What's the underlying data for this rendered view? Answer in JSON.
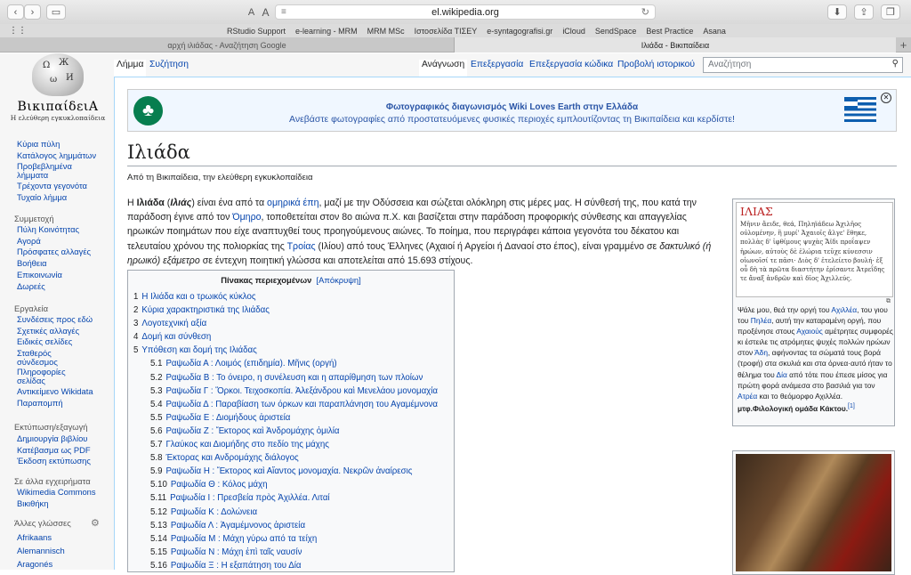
{
  "browser": {
    "address": "el.wikipedia.org",
    "favorites": [
      "RStudio Support",
      "e-learning - MRM",
      "MRM MSc",
      "Ιστοσελίδα ΤΙΣΕΥ",
      "e-syntagografisi.gr",
      "iCloud",
      "SendSpace",
      "Best Practice",
      "Asana"
    ],
    "tabs": [
      "αρχή ιλιάδας - Αναζήτηση Google",
      "Ιλιάδα - Βικιπαίδεια"
    ],
    "reader_a_small": "A",
    "reader_a_large": "A"
  },
  "logo": {
    "wordmark": "ΒικιπαίδειΑ",
    "tagline": "Η ελεύθερη εγκυκλοπαίδεια"
  },
  "nav": {
    "main": [
      "Κύρια πύλη",
      "Κατάλογος λημμάτων",
      "Προβεβλημένα λήμματα",
      "Τρέχοντα γεγονότα",
      "Τυχαίο λήμμα"
    ],
    "community_head": "Συμμετοχή",
    "community": [
      "Πύλη Κοινότητας",
      "Αγορά",
      "Πρόσφατες αλλαγές",
      "Βοήθεια",
      "Επικοινωνία",
      "Δωρεές"
    ],
    "tools_head": "Εργαλεία",
    "tools": [
      "Συνδέσεις προς εδώ",
      "Σχετικές αλλαγές",
      "Ειδικές σελίδες",
      "Σταθερός σύνδεσμος",
      "Πληροφορίες σελίδας",
      "Αντικείμενο Wikidata",
      "Παραπομπή"
    ],
    "print_head": "Εκτύπωση/εξαγωγή",
    "print": [
      "Δημιουργία βιβλίου",
      "Κατέβασμα ως PDF",
      "Έκδοση εκτύπωσης"
    ],
    "projects_head": "Σε άλλα εγχειρήματα",
    "projects": [
      "Wikimedia Commons",
      "Βικιθήκη"
    ],
    "lang_head": "Άλλες γλώσσες",
    "langs": [
      "Afrikaans",
      "Alemannisch",
      "Aragonés"
    ]
  },
  "tabs": {
    "article": "Λήμμα",
    "talk": "Συζήτηση",
    "read": "Ανάγνωση",
    "edit": "Επεξεργασία",
    "edit_code": "Επεξεργασία κώδικα",
    "history": "Προβολή ιστορικού",
    "search_placeholder": "Αναζήτηση"
  },
  "banner": {
    "title": "Φωτογραφικός διαγωνισμός Wiki Loves Earth στην Ελλάδα",
    "text": "Ανεβάστε φωτογραφίες από προστατευόμενες φυσικές περιοχές εμπλουτίζοντας τη Βικιπαίδεια και κερδίστε!"
  },
  "article": {
    "title": "Ιλιάδα",
    "from": "Από τη Βικιπαίδεια, την ελεύθερη εγκυκλοπαίδεια",
    "p": [
      "Η ",
      "Ιλιάδα",
      " (",
      "Ιλιάς",
      ") είναι ένα από τα ",
      "ομηρικά έπη",
      ", μαζί με την Οδύσσεια και σώζεται ολόκληρη στις μέρες μας. Η σύνθεσή της, που κατά την παράδοση έγινε από τον ",
      "Όμηρο",
      ", τοποθετείται στον 8ο αιώνα π.Χ. και βασίζεται στην παράδοση προφορικής σύνθεσης και απαγγελίας ηρωικών ποιημάτων που είχε αναπτυχθεί τους προηγούμενους αιώνες. Το ποίημα, που περιγράφει κάποια γεγονότα του δέκατου και τελευταίου χρόνου της πολιορκίας της ",
      "Τροίας",
      " (Ιλίου) από τους Έλληνες (Αχαιοί ή Αργείοι ή Δαναοί στο έπος), είναι γραμμένο σε ",
      "δακτυλικό (ή ηρωικό) εξάμετρο",
      " σε έντεχνη ποιητική γλώσσα και αποτελείται από 15.693 στίχους."
    ]
  },
  "toc": {
    "title": "Πίνακας περιεχομένων",
    "hide": "[Απόκρυψη]",
    "items": [
      {
        "n": "1",
        "t": "Η Ιλιάδα και ο τρωικός κύκλος",
        "sub": false
      },
      {
        "n": "2",
        "t": "Κύρια χαρακτηριστικά της Ιλιάδας",
        "sub": false
      },
      {
        "n": "3",
        "t": "Λογοτεχνική αξία",
        "sub": false
      },
      {
        "n": "4",
        "t": "Δομή και σύνθεση",
        "sub": false
      },
      {
        "n": "5",
        "t": "Υπόθεση και δομή της Ιλιάδας",
        "sub": false
      },
      {
        "n": "5.1",
        "t": "Ραψωδία Α : Λοιμός (επιδημία). Μῆνις (οργή)",
        "sub": true
      },
      {
        "n": "5.2",
        "t": "Ραψωδία Β : Το όνειρο, η συνέλευση και η απαρίθμηση των πλοίων",
        "sub": true
      },
      {
        "n": "5.3",
        "t": "Ραψωδία Γ : Ὅρκοι. Τειχοσκοπία. Ἀλεξάνδρου καὶ Μενελάου μονομαχία",
        "sub": true
      },
      {
        "n": "5.4",
        "t": "Ραψωδία Δ : Παραβίαση των όρκων και παραπλάνηση του Αγαμέμνονα",
        "sub": true
      },
      {
        "n": "5.5",
        "t": "Ραψωδία Ε : Διομήδους ἀριστεία",
        "sub": true
      },
      {
        "n": "5.6",
        "t": "Ραψωδία Ζ : Ἕκτορος καὶ Ἀνδρομάχης ὁμιλία",
        "sub": true
      },
      {
        "n": "5.7",
        "t": "Γλαύκος και Διομήδης στο πεδίο της μάχης",
        "sub": true
      },
      {
        "n": "5.8",
        "t": "Έκτορας και Ανδρομάχης διάλογος",
        "sub": true
      },
      {
        "n": "5.9",
        "t": "Ραψωδία Η : Ἕκτορος καὶ Αἴαντος μονομαχία. Νεκρῶν ἀναίρεσις",
        "sub": true
      },
      {
        "n": "5.10",
        "t": "Ραψωδία Θ : Κόλος μάχη",
        "sub": true
      },
      {
        "n": "5.11",
        "t": "Ραψωδία Ι : Πρεσβεία πρὸς Ἀχιλλέα. Λιταί",
        "sub": true
      },
      {
        "n": "5.12",
        "t": "Ραψωδία Κ : Δολώνεια",
        "sub": true
      },
      {
        "n": "5.13",
        "t": "Ραψωδία Λ : Ἀγαμέμνονος ἀριστεία",
        "sub": true
      },
      {
        "n": "5.14",
        "t": "Ραψωδία Μ : Μάχη γύρω από τα τείχη",
        "sub": true
      },
      {
        "n": "5.15",
        "t": "Ραψωδία Ν : Μάχη ἐπὶ ταῖς ναυσίν",
        "sub": true
      },
      {
        "n": "5.16",
        "t": "Ραψωδία Ξ : Η εξαπάτηση του Δία",
        "sub": true
      }
    ]
  },
  "infobox": {
    "greek_title": "ΙΛΙΑΣ",
    "greek_text": "Μῆνιν ἄειδε, θεά, Πηληϊάδεω Ἀχιλῆος οὐλομένην, ἣ μυρί' Ἀχαιοῖς ἄλγε' ἔθηκε, πολλὰς δ' ἰφθίμους ψυχὰς Ἄϊδι προΐαψεν ἡρώων, αὐτοὺς δὲ ἑλώρια τεῦχε κύνεσσιν οἰωνοῖσί τε πᾶσι· Διὸς δ' ἐτελείετο βουλή· ἐξ οὗ δὴ τὰ πρῶτα διαστήτην ἐρίσαντε Ἀτρεΐδης τε ἄναξ ἀνδρῶν καὶ δῖος Ἀχιλλεύς.",
    "tr": [
      "Ψάλε μου, θεά την οργή του ",
      "Αχιλλέα",
      ", του γιου του ",
      "Πηλέα",
      ", αυτή την καταραμένη οργή, που προξένησε στους ",
      "Αχαιούς",
      " αμέτρητες συμφορές κι έστειλε τις ατρόμητες ψυχές πολλών ηρώων στον ",
      "Άδη",
      ", αφήνοντας τα σώματά τους βορά (τροφή) στα σκυλιά και στα όρνεα·αυτό ήταν το θέλημα του ",
      "Δία",
      " από τότε που έπεσε μίσος για πρώτη φορά ανάμεσα στο βασιλιά για τον ",
      "Ατρέα",
      " και το θεόμορφο Αχιλλέα."
    ],
    "credit": "μτφ.Φιλολογική ομάδα Κάκτου.",
    "ref": "[1]"
  }
}
